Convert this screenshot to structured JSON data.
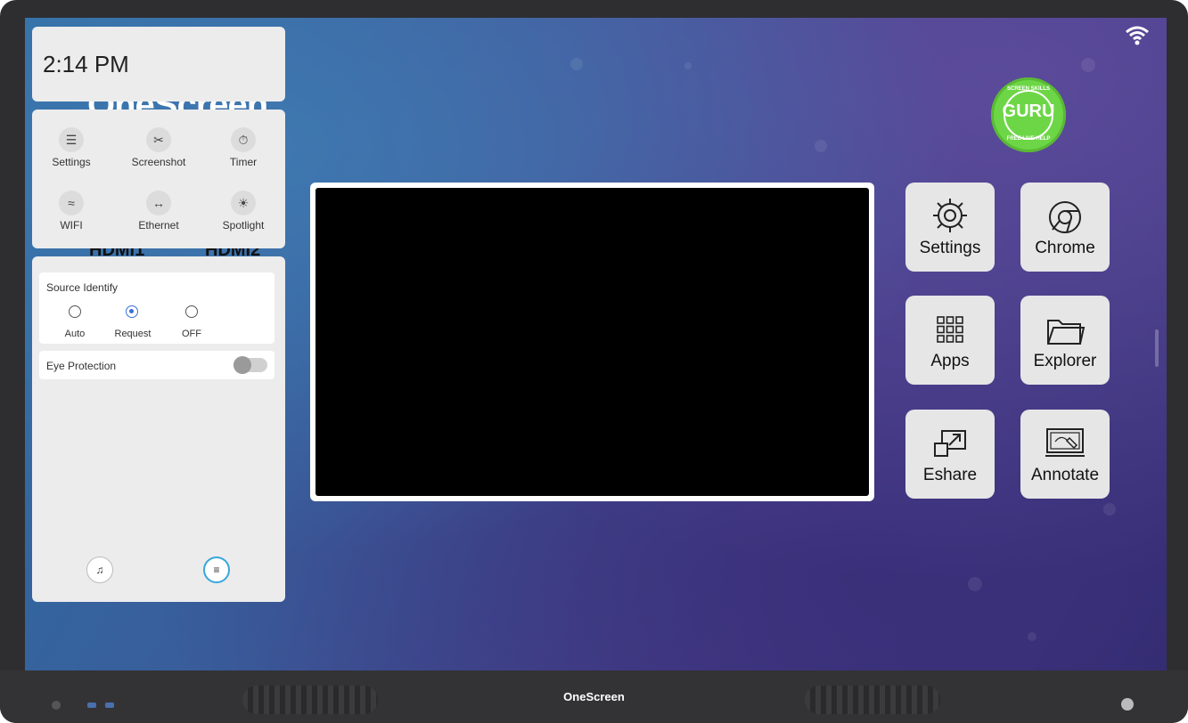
{
  "status": {
    "wifi_icon": "wifi-icon"
  },
  "clock": {
    "time": "2:14 PM"
  },
  "brand": {
    "logo_text": "OneScreen",
    "bezel_label": "OneScreen"
  },
  "guru_badge": {
    "main": "GURU",
    "top": "SCREEN SKILLS",
    "bottom": "FREE LIVE HELP"
  },
  "quick_tools": [
    {
      "label": "Settings",
      "icon": "sliders-icon"
    },
    {
      "label": "Screenshot",
      "icon": "screenshot-icon"
    },
    {
      "label": "Timer",
      "icon": "timer-icon"
    },
    {
      "label": "WIFI",
      "icon": "wifi-icon"
    },
    {
      "label": "Ethernet",
      "icon": "ethernet-icon"
    },
    {
      "label": "Spotlight",
      "icon": "spotlight-icon"
    }
  ],
  "sources": {
    "hdmi1": "HDMI1",
    "hdmi2": "HDMI2"
  },
  "source_identify": {
    "title": "Source Identify",
    "options": [
      "Auto",
      "Request",
      "OFF"
    ],
    "selected": "Request"
  },
  "eye_protection": {
    "label": "Eye Protection",
    "enabled": false
  },
  "bottom_buttons": {
    "music_icon": "music-icon",
    "menu_icon": "menu-icon"
  },
  "apps": [
    {
      "label": "Settings",
      "icon": "gear-icon"
    },
    {
      "label": "Chrome",
      "icon": "chrome-icon"
    },
    {
      "label": "Apps",
      "icon": "grid-icon"
    },
    {
      "label": "Explorer",
      "icon": "folder-icon"
    },
    {
      "label": "Eshare",
      "icon": "screen-share-icon"
    },
    {
      "label": "Annotate",
      "icon": "annotate-icon"
    }
  ],
  "colors": {
    "accent": "#3a6fd8",
    "guru_green": "#6dd646",
    "menu_ring": "#38a7dc"
  }
}
